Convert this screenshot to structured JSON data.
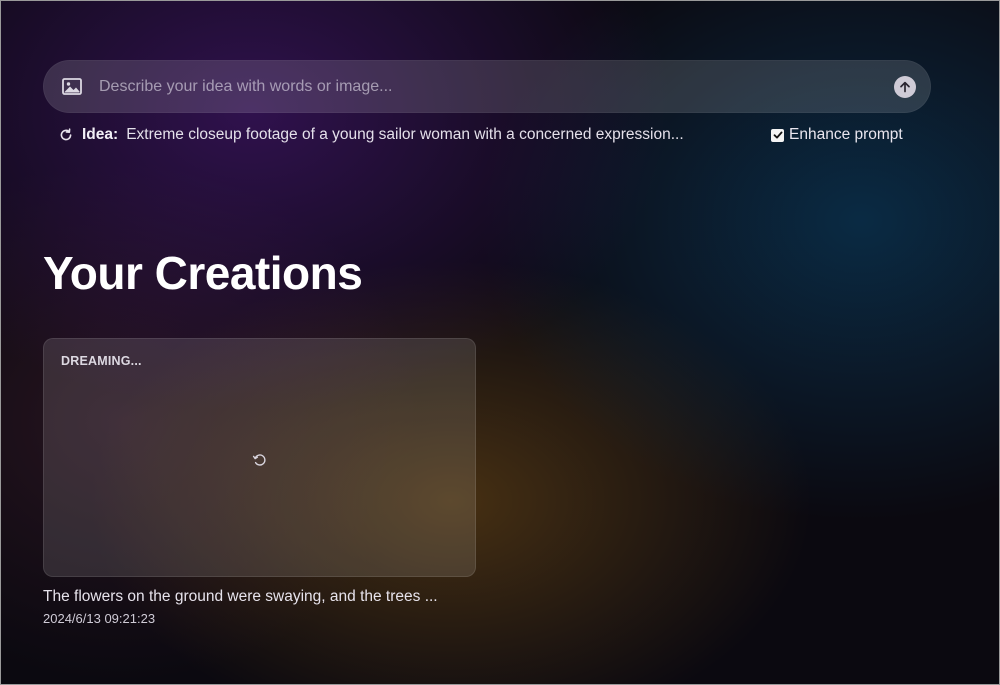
{
  "prompt": {
    "placeholder": "Describe your idea with words or image...",
    "value": ""
  },
  "idea": {
    "label": "Idea:",
    "text": "Extreme closeup footage of a young sailor woman with a concerned expression..."
  },
  "enhance": {
    "label": "Enhance prompt",
    "checked": true
  },
  "main": {
    "title": "Your Creations",
    "creations": [
      {
        "status": "DREAMING...",
        "caption": "The flowers on the ground were swaying, and the trees ...",
        "timestamp": "2024/6/13 09:21:23"
      }
    ]
  },
  "icons": {
    "image": "image-icon",
    "send": "arrow-up-icon",
    "refresh": "refresh-icon",
    "loading": "loading-spinner-icon",
    "checkbox": "checkmark-icon"
  }
}
